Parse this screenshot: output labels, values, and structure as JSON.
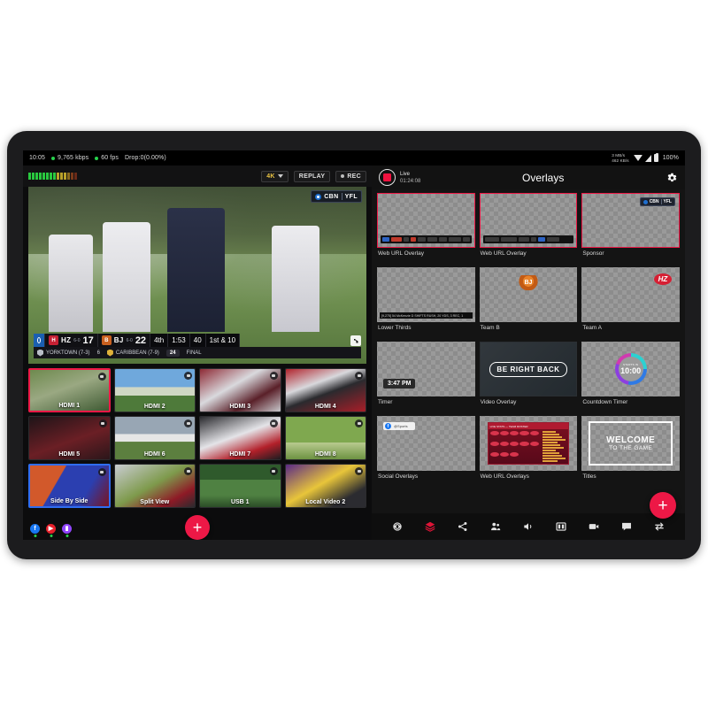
{
  "statusbar": {
    "time": "10:05",
    "bitrate": "9,765 kbps",
    "fps": "60 fps",
    "drops": "Drop:0(0.00%)",
    "net_down": "3 MB/s",
    "net_up": "462 KB/s",
    "battery": "100%"
  },
  "left_toolbar": {
    "resolution": "4K",
    "replay_label": "REPLAY",
    "rec_label": "REC"
  },
  "program": {
    "broadcaster_left": "CBN",
    "broadcaster_right": "YFL",
    "scoreboard": {
      "team_a_abbr": "HZ",
      "team_a_record": "6-0",
      "team_a_score": "17",
      "team_b_abbr": "BJ",
      "team_b_record": "6-0",
      "team_b_score": "22",
      "quarter": "4th",
      "clock": "1:53",
      "ball_on": "40",
      "down_distance": "1st & 10"
    },
    "ticker": {
      "away_team": "YORKTOWN (7-3)",
      "away_score": "6",
      "home_team": "CARIBBEAN (7-9)",
      "home_score": "24",
      "status": "FINAL"
    }
  },
  "sources": [
    {
      "label": "HDMI 1",
      "selected": "red"
    },
    {
      "label": "HDMI 2",
      "selected": "none"
    },
    {
      "label": "HDMI 3",
      "selected": "none"
    },
    {
      "label": "HDMI 4",
      "selected": "none"
    },
    {
      "label": "HDMI 5",
      "selected": "none"
    },
    {
      "label": "HDMI 6",
      "selected": "none"
    },
    {
      "label": "HDMI 7",
      "selected": "none"
    },
    {
      "label": "HDMI 8",
      "selected": "none"
    },
    {
      "label": "Side By Side",
      "selected": "blue"
    },
    {
      "label": "Split View",
      "selected": "none"
    },
    {
      "label": "USB 1",
      "selected": "none"
    },
    {
      "label": "Local Video 2",
      "selected": "none"
    }
  ],
  "left_bottom": {
    "socials": [
      {
        "name": "facebook",
        "glyph": "f",
        "color": "#1877f2"
      },
      {
        "name": "youtube",
        "glyph": "▶",
        "color": "#e8202a"
      },
      {
        "name": "twitch",
        "glyph": "▮",
        "color": "#9146ff"
      }
    ],
    "add_label": "+"
  },
  "right_header": {
    "live_label": "Live",
    "live_timecode": "01:24:08",
    "title": "Overlays"
  },
  "overlays": [
    {
      "label": "Web URL Overlay",
      "kind": "weburl",
      "active": true
    },
    {
      "label": "Web URL Overlay",
      "kind": "weburl2",
      "active": true
    },
    {
      "label": "Sponsor",
      "kind": "sponsor",
      "active": true
    },
    {
      "label": "Lower Thirds",
      "kind": "lowerthirds",
      "active": false,
      "strip_text": "[9,275] 54 McKenzie D SHIFTS RUSH, 20 YDS, 3 REC, 1"
    },
    {
      "label": "Team B",
      "kind": "teamb",
      "active": false
    },
    {
      "label": "Team A",
      "kind": "teama",
      "active": false
    },
    {
      "label": "Timer",
      "kind": "timer",
      "active": false,
      "chip_text": "3:47 PM"
    },
    {
      "label": "Video Overlay",
      "kind": "video",
      "active": false,
      "card_text": "BE RIGHT BACK"
    },
    {
      "label": "Countdown Timer",
      "kind": "countdown",
      "active": false,
      "cd_caption": "STARTS IN",
      "cd_value": "10:00"
    },
    {
      "label": "Social Overlays",
      "kind": "social",
      "active": false,
      "chip_text": "@Sports"
    },
    {
      "label": "Web URL Overlays",
      "kind": "stats",
      "active": false,
      "gfx_title": "LIVE STATS — TEAM ROSTER"
    },
    {
      "label": "Titles",
      "kind": "titles",
      "active": false,
      "title_line1": "WELCOME",
      "title_line2": "TO THE GAME"
    }
  ],
  "bottom_toolbar": {
    "items": [
      {
        "name": "settings-icon",
        "active": false
      },
      {
        "name": "layers-icon",
        "active": true
      },
      {
        "name": "share-icon",
        "active": false
      },
      {
        "name": "guests-icon",
        "active": false
      },
      {
        "name": "audio-icon",
        "active": false
      },
      {
        "name": "scoreboard-icon",
        "active": false
      },
      {
        "name": "media-icon",
        "active": false
      },
      {
        "name": "chat-icon",
        "active": false
      },
      {
        "name": "transition-icon",
        "active": false
      }
    ],
    "add_label": "+"
  }
}
